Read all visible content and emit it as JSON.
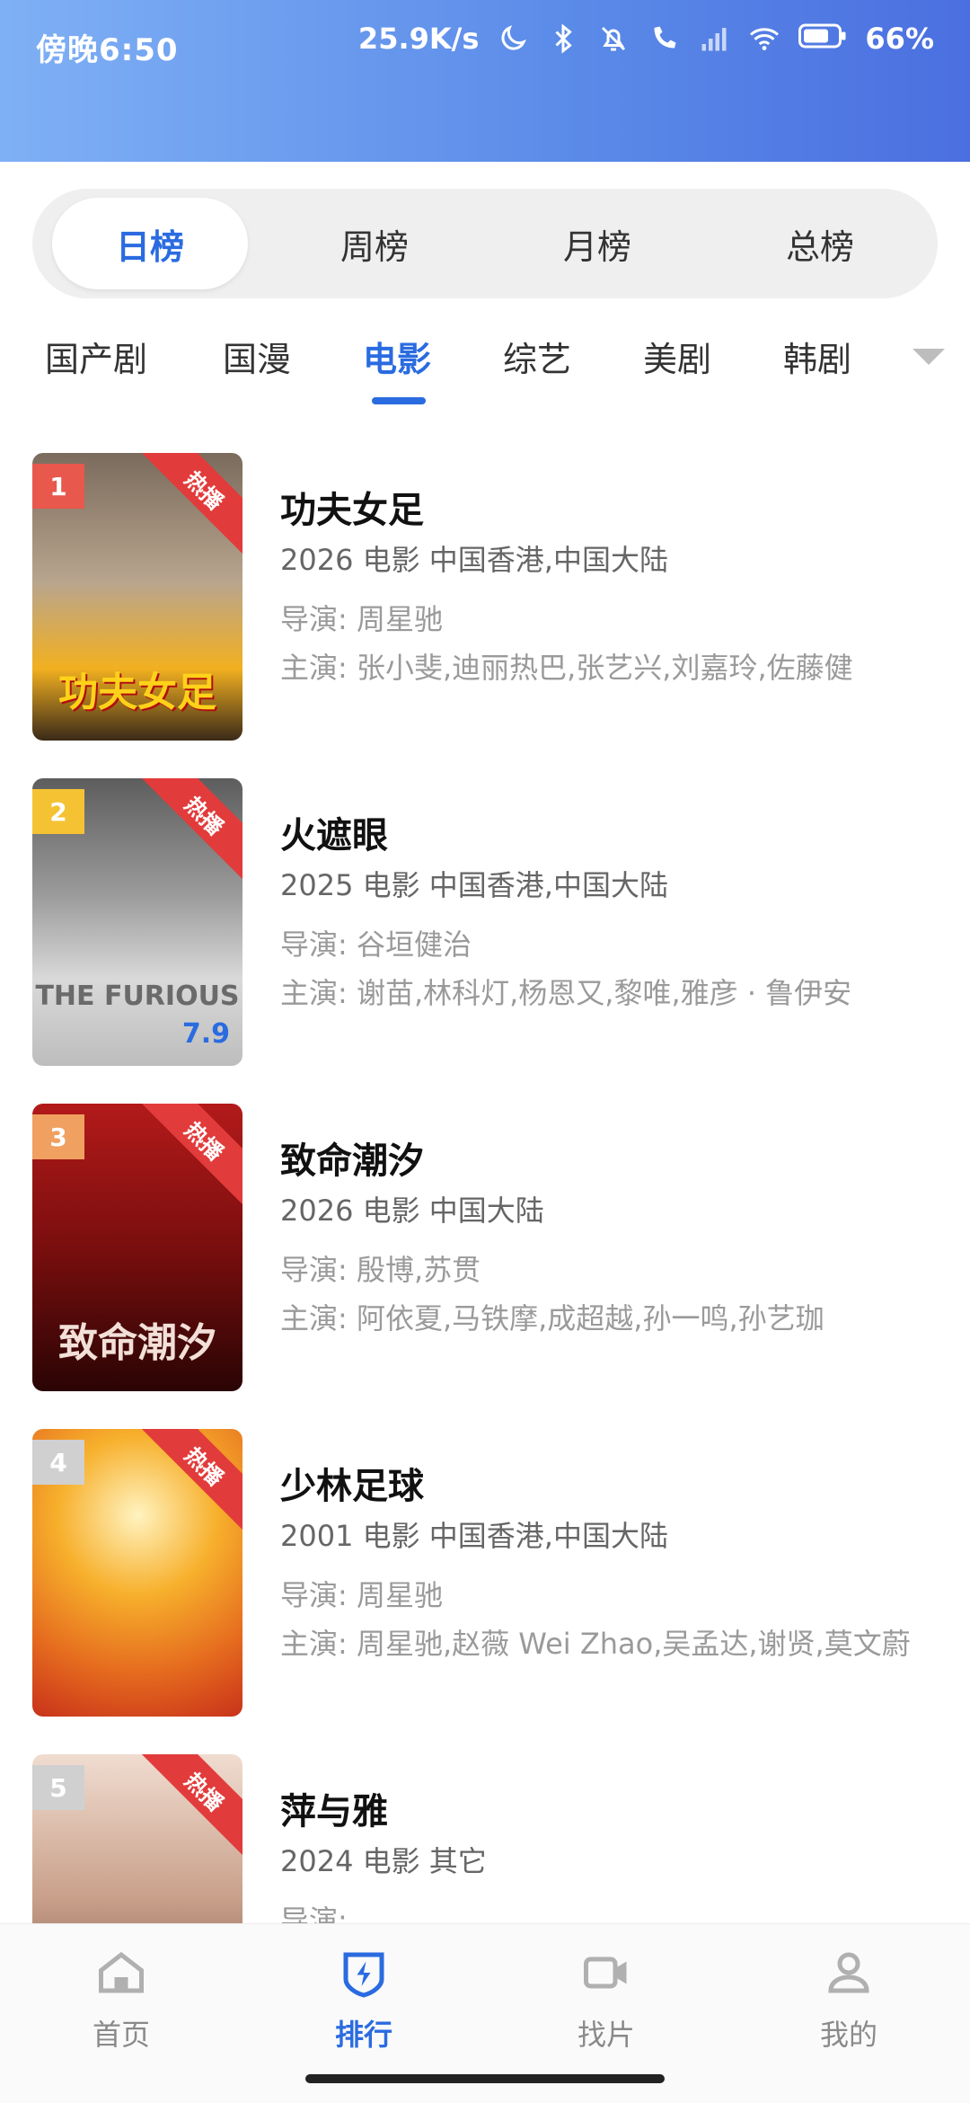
{
  "status_bar": {
    "time": "傍晚6:50",
    "net_speed": "25.9K/s",
    "battery": "66%",
    "icons": [
      "moon-icon",
      "bluetooth-icon",
      "mute-bell-icon",
      "call-icon",
      "signal-icon",
      "wifi-icon",
      "battery-icon"
    ]
  },
  "period_tabs": [
    {
      "label": "日榜",
      "active": true
    },
    {
      "label": "周榜",
      "active": false
    },
    {
      "label": "月榜",
      "active": false
    },
    {
      "label": "总榜",
      "active": false
    }
  ],
  "category_tabs": [
    {
      "label": "国产剧"
    },
    {
      "label": "国漫"
    },
    {
      "label": "电影",
      "active": true
    },
    {
      "label": "综艺"
    },
    {
      "label": "美剧"
    },
    {
      "label": "韩剧"
    }
  ],
  "items": [
    {
      "rank": "1",
      "hot": "热播",
      "title": "功夫女足",
      "meta": "2026  电影  中国香港,中国大陆",
      "director": "导演: 周星驰",
      "cast": "主演: 张小斐,迪丽热巴,张艺兴,刘嘉玲,佐藤健",
      "poster_text": "功夫女足",
      "poster_score": "",
      "rank_color": "#e8584c",
      "poster_colors": [
        "#f4a21b",
        "#3a2a18"
      ]
    },
    {
      "rank": "2",
      "hot": "热播",
      "title": "火遮眼",
      "meta": "2025  电影  中国香港,中国大陆",
      "director": "导演: 谷垣健治",
      "cast": "主演: 谢苗,林科灯,杨恩又,黎唯,雅彦 · 鲁伊安",
      "poster_text": "THE FURIOUS",
      "poster_score": "7.9",
      "rank_color": "#f4c233",
      "poster_colors": [
        "#c8c8c8",
        "#3a3a3a"
      ]
    },
    {
      "rank": "3",
      "hot": "热播",
      "title": "致命潮汐",
      "meta": "2026  电影  中国大陆",
      "director": "导演: 殷博,苏贯",
      "cast": "主演: 阿依夏,马铁摩,成超越,孙一鸣,孙艺珈",
      "poster_text": "致命潮汐",
      "poster_score": "",
      "rank_color": "#f0a060",
      "poster_colors": [
        "#a11616",
        "#2a0404"
      ]
    },
    {
      "rank": "4",
      "hot": "热播",
      "title": "少林足球",
      "meta": "2001  电影  中国香港,中国大陆",
      "director": "导演: 周星驰",
      "cast": "主演: 周星驰,赵薇 Wei Zhao,吴孟达,谢贤,莫文蔚",
      "poster_text": "",
      "poster_score": "",
      "rank_color": "#d0d0d0",
      "poster_colors": [
        "#f39a1a",
        "#e0421e"
      ]
    },
    {
      "rank": "5",
      "hot": "热播",
      "title": "萍与雅",
      "meta": "2024  电影  其它",
      "director": "导演: ...",
      "cast": "",
      "poster_text": "",
      "poster_score": "",
      "rank_color": "#d0d0d0",
      "poster_colors": [
        "#caa18a",
        "#6a4a3e"
      ]
    }
  ],
  "bottom_nav": [
    {
      "label": "首页",
      "icon": "home-icon"
    },
    {
      "label": "排行",
      "icon": "ranking-icon",
      "active": true
    },
    {
      "label": "找片",
      "icon": "video-camera-icon"
    },
    {
      "label": "我的",
      "icon": "profile-icon"
    }
  ],
  "colors": {
    "accent": "#2a6be0",
    "hot": "#e23b3b"
  }
}
